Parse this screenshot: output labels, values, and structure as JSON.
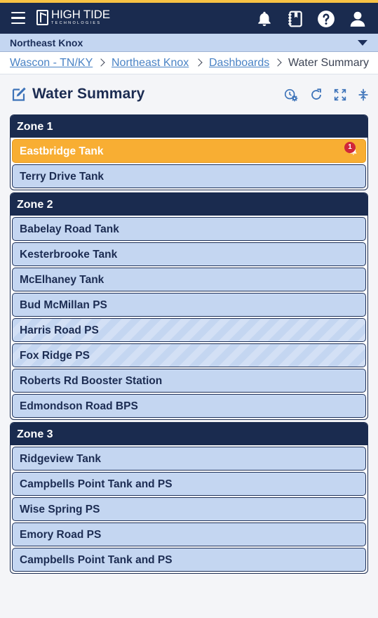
{
  "header": {
    "logo_main": "HIGH TIDE",
    "logo_sub": "TECHNOLOGIES",
    "icons": [
      "menu-icon",
      "bell-icon",
      "notebook-icon",
      "help-icon",
      "user-icon"
    ]
  },
  "tenant": {
    "selected": "Northeast Knox"
  },
  "breadcrumb": {
    "items": [
      "Wascon - TN/KY",
      "Northeast Knox",
      "Dashboards"
    ],
    "current": "Water Summary"
  },
  "page": {
    "title": "Water Summary",
    "tools": [
      "settings-gear-icon",
      "refresh-icon",
      "expand-icon",
      "collapse-icon"
    ]
  },
  "zones": [
    {
      "name": "Zone 1",
      "stations": [
        {
          "name": "Eastbridge Tank",
          "alarm_count": "1"
        },
        {
          "name": "Terry Drive Tank"
        }
      ]
    },
    {
      "name": "Zone 2",
      "stations": [
        {
          "name": "Babelay Road Tank"
        },
        {
          "name": "Kesterbrooke Tank"
        },
        {
          "name": "McElhaney Tank"
        },
        {
          "name": "Bud McMillan PS"
        },
        {
          "name": "Harris Road PS"
        },
        {
          "name": "Fox Ridge PS"
        },
        {
          "name": "Roberts Rd Booster Station"
        },
        {
          "name": "Edmondson Road BPS"
        }
      ]
    },
    {
      "name": "Zone 3",
      "stations": [
        {
          "name": "Ridgeview Tank"
        },
        {
          "name": "Campbells Point Tank and PS"
        },
        {
          "name": "Wise Spring PS"
        },
        {
          "name": "Emory Road PS"
        },
        {
          "name": "Campbells Point Tank and PS"
        }
      ]
    }
  ],
  "colors": {
    "navy": "#1a2b4f",
    "accent": "#f7c244",
    "station_bg": "#c4d6f1",
    "alarm": "#f8ae33",
    "badge": "#d0273a",
    "link": "#4a83c5"
  }
}
